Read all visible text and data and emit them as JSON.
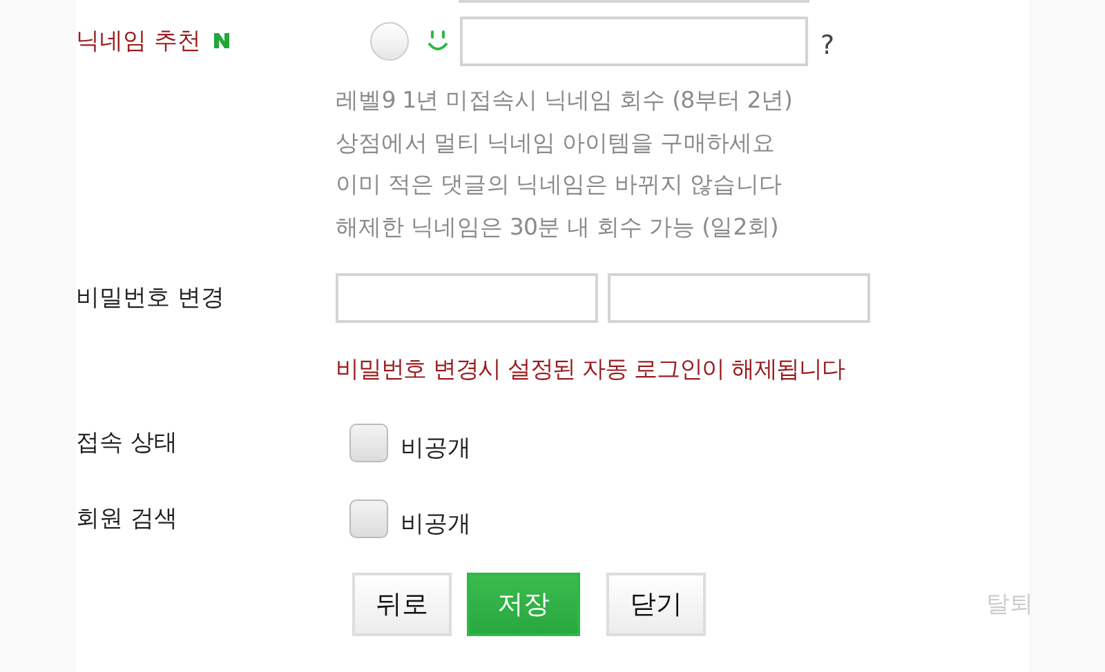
{
  "nickname_recommend": {
    "label": "닉네임 추천",
    "radio_selected": false,
    "help_mark": "?",
    "notes": [
      "레벨9 1년 미접속시 닉네임 회수 (8부터 2년)",
      "상점에서 멀티 닉네임 아이템을 구매하세요",
      "이미 적은 댓글의 닉네임은 바뀌지 않습니다",
      "해제한 닉네임은 30분 내 회수 가능 (일2회)"
    ]
  },
  "password_change": {
    "label": "비밀번호 변경",
    "warning": "비밀번호 변경시 설정된 자동 로그인이 해제됩니다"
  },
  "privacy": [
    {
      "label": "접속 상태",
      "option": "비공개",
      "checked": false
    },
    {
      "label": "회원 검색",
      "option": "비공개",
      "checked": false
    }
  ],
  "buttons": [
    {
      "label": "뒤로",
      "kind": "default"
    },
    {
      "label": "저장",
      "kind": "primary"
    },
    {
      "label": "닫기",
      "kind": "default"
    }
  ],
  "withdraw_link": "탈퇴"
}
